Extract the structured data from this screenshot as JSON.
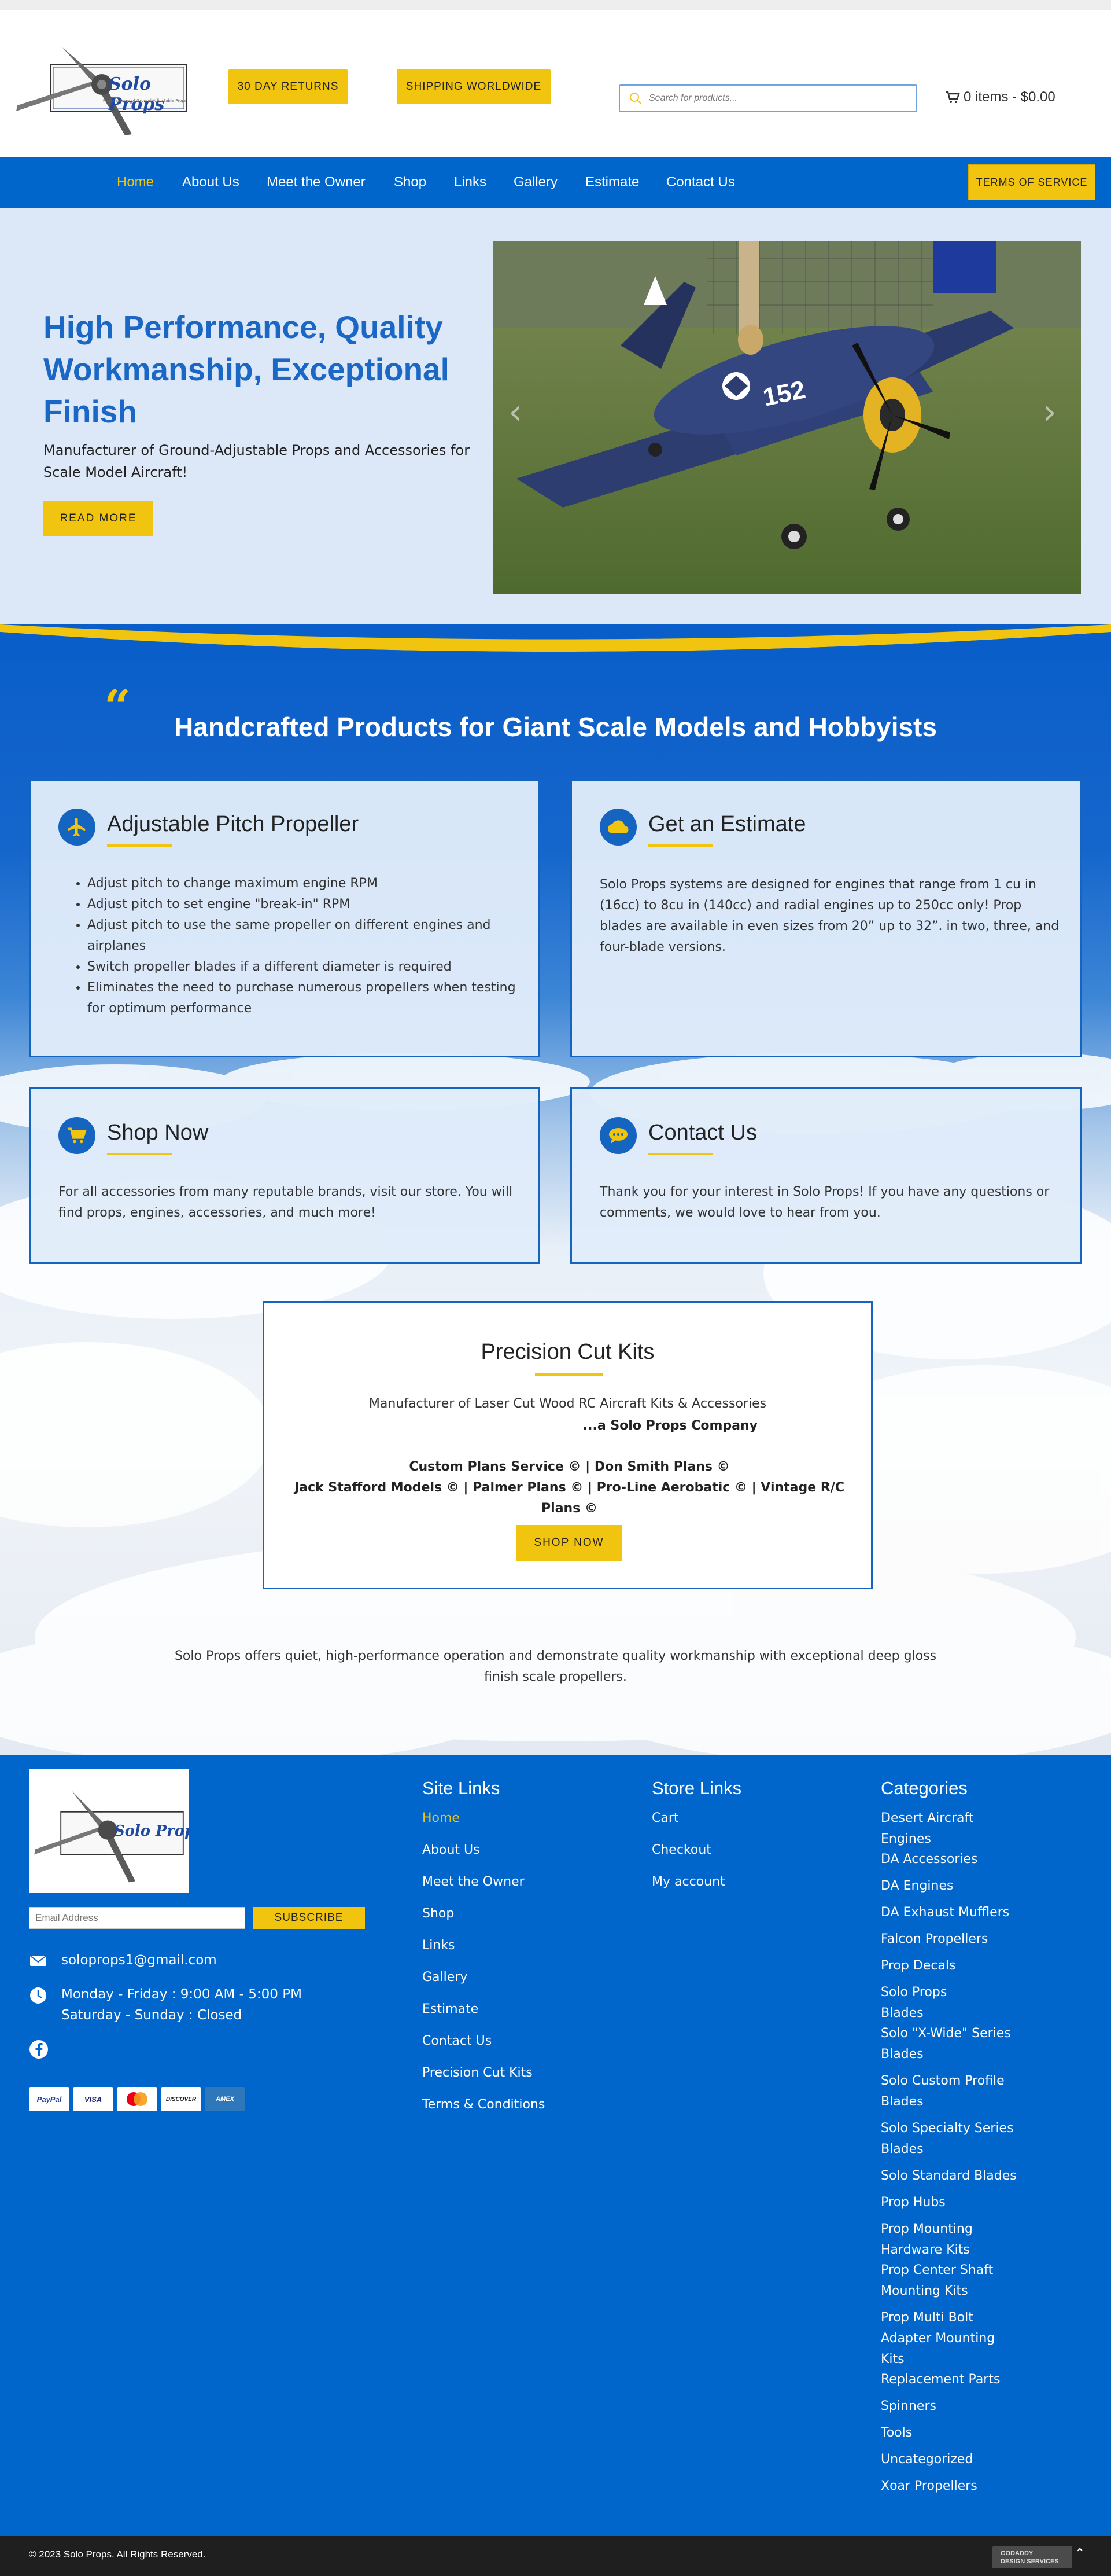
{
  "header": {
    "logo_text": "Solo Props",
    "logo_tagline": "Manufacturer of Ground-Adjustable Props",
    "promo_returns": "30 DAY RETURNS",
    "promo_shipping": "SHIPPING WORLDWIDE",
    "search_placeholder": "Search for products...",
    "cart_label": "0 items - $0.00"
  },
  "nav": {
    "items": [
      "Home",
      "About Us",
      "Meet the Owner",
      "Shop",
      "Links",
      "Gallery",
      "Estimate",
      "Contact Us"
    ],
    "active": "Home",
    "tos_label": "TERMS OF SERVICE"
  },
  "hero": {
    "title": "High Performance, Quality Workmanship, Exceptional Finish",
    "subtitle": "Manufacturer of Ground-Adjustable Props and Accessories for Scale Model Aircraft!",
    "cta": "READ MORE",
    "plane_number": "152",
    "prev_arrow": "‹",
    "next_arrow": "›"
  },
  "section": {
    "quote_glyph": "“",
    "title": "Handcrafted Products for Giant Scale Models and Hobbyists"
  },
  "cards": {
    "propeller": {
      "title": "Adjustable Pitch Propeller",
      "bullets": [
        "Adjust pitch to change maximum engine RPM",
        "Adjust pitch to set engine \"break-in\" RPM",
        "Adjust pitch to use the same propeller on different engines and airplanes",
        "Switch propeller blades if a different diameter is required",
        "Eliminates the need to purchase numerous propellers when testing for optimum performance"
      ]
    },
    "estimate": {
      "title": "Get an Estimate",
      "body": "Solo Props systems are designed for engines that range from 1 cu in (16cc) to 8cu in (140cc) and radial engines up to 250cc only! Prop blades are available in even sizes from 20” up to 32”. in two, three, and four-blade versions."
    },
    "shop": {
      "title": "Shop Now",
      "body": "For all accessories from many reputable brands, visit our store. You will find props, engines, accessories, and much more!"
    },
    "contact": {
      "title": "Contact Us",
      "body": "Thank you for your interest in Solo Props! If you have any questions or comments, we would love to hear from you."
    }
  },
  "kits": {
    "title": "Precision Cut Kits",
    "line1": "Manufacturer of Laser Cut Wood RC Aircraft Kits & Accessories",
    "company": "...a Solo Props Company",
    "plans_line1": "Custom Plans Service © | Don Smith Plans ©",
    "plans_line2": "Jack Stafford Models © | Palmer Plans © | Pro-Line Aerobatic © | Vintage R/C Plans ©",
    "cta": "SHOP NOW"
  },
  "main_note": "Solo Props offers quiet, high-performance operation and demonstrate quality workmanship with exceptional deep gloss finish scale propellers.",
  "footer": {
    "email_placeholder": "Email Address",
    "subscribe": "SUBSCRIBE",
    "email": "soloprops1@gmail.com",
    "hours_line1": "Monday - Friday : 9:00 AM - 5:00 PM",
    "hours_line2": "Saturday - Sunday : Closed",
    "payments": [
      "PayPal",
      "VISA",
      "MC",
      "DISCOVER",
      "AMEX"
    ],
    "site_links_title": "Site Links",
    "site_links": [
      "Home",
      "About Us",
      "Meet the Owner",
      "Shop",
      "Links",
      "Gallery",
      "Estimate",
      "Contact Us",
      "Precision Cut Kits",
      "Terms & Conditions"
    ],
    "store_links_title": "Store Links",
    "store_links": [
      "Cart",
      "Checkout",
      "My account"
    ],
    "categories_title": "Categories",
    "categories": [
      "Desert Aircraft Engines",
      "DA Accessories",
      "DA Engines",
      "DA Exhaust Mufflers",
      "Falcon Propellers",
      "Prop Decals",
      "Solo Props Blades",
      "Solo \"X-Wide\" Series Blades",
      "Solo Custom Profile Blades",
      "Solo Specialty Series Blades",
      "Solo Standard Blades",
      "Prop Hubs",
      "Prop Mounting Hardware Kits",
      "Prop Center Shaft Mounting Kits",
      "Prop Multi Bolt Adapter Mounting Kits",
      "Replacement Parts",
      "Spinners",
      "Tools",
      "Uncategorized",
      "Xoar Propellers"
    ]
  },
  "bottom": {
    "copyright": "© 2023 Solo Props. All Rights Reserved.",
    "badge_line1": "GODADDY",
    "badge_line2": "DESIGN SERVICES",
    "to_top": "⌃"
  },
  "colors": {
    "brand_blue": "#0066cc",
    "accent_yellow": "#f1c40f",
    "hero_bg": "#dce8f8"
  },
  "icons": [
    "search-icon",
    "cart-icon",
    "plane-icon",
    "cloud-icon",
    "cart-icon",
    "chat-icon",
    "email-icon",
    "clock-icon",
    "facebook-icon"
  ]
}
